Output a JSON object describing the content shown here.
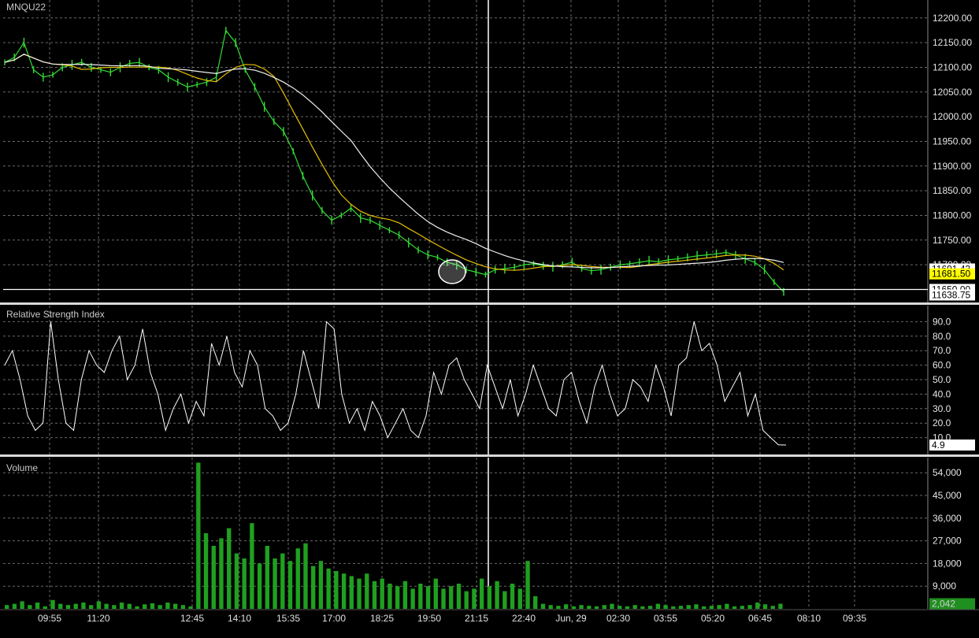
{
  "symbol": "MNQU22",
  "price_panel": {
    "title": "MNQU22",
    "y_ticks": [
      "12200.00",
      "12150.00",
      "12100.00",
      "12050.00",
      "12000.00",
      "11950.00",
      "11900.00",
      "11850.00",
      "11800.00",
      "11750.00",
      "11700.00"
    ],
    "labels": [
      {
        "text": "11691.43",
        "value": 11691.43,
        "bg": "#ffffff",
        "fg": "#000000"
      },
      {
        "text": "11681.50",
        "value": 11681.5,
        "bg": "#ffff00",
        "fg": "#000000"
      },
      {
        "text": "11650.00",
        "value": 11650,
        "bg": "#ffffff",
        "fg": "#000000"
      },
      {
        "text": "11638.75",
        "value": 11638.75,
        "bg": "#ffffff",
        "fg": "#000000"
      }
    ],
    "horizontal_line": 11650
  },
  "rsi_panel": {
    "title": "Relative Strength Index",
    "y_ticks": [
      "90.0",
      "80.0",
      "70.0",
      "60.0",
      "50.0",
      "40.0",
      "30.0",
      "20.0",
      "10.0"
    ],
    "last_label": "4.9"
  },
  "volume_panel": {
    "title": "Volume",
    "y_ticks": [
      "54,000",
      "45,000",
      "36,000",
      "27,000",
      "18,000",
      "9,000"
    ],
    "last_label": "2,042"
  },
  "x_ticks": [
    "09:55",
    "11:20",
    "12:45",
    "14:10",
    "15:35",
    "17:00",
    "18:25",
    "19:50",
    "21:15",
    "22:40",
    "Jun, 29",
    "02:30",
    "03:55",
    "05:20",
    "06:45",
    "08:10",
    "09:35"
  ],
  "colors": {
    "candle": "#33dd33",
    "ma_fast": "#e8c000",
    "ma_slow": "#f0f0f0",
    "rsi": "#ffffff",
    "volume": "#1fa01f",
    "grid": "#6a6a6a",
    "cursor": "#ffffff"
  },
  "chart_data": [
    {
      "type": "line",
      "title": "MNQU22",
      "ylim": [
        11630,
        12230
      ],
      "x_label_times": [
        "09:55",
        "11:20",
        "12:45",
        "14:10",
        "15:35",
        "17:00",
        "18:25",
        "19:50",
        "21:15",
        "22:40",
        "Jun, 29",
        "02:30",
        "03:55",
        "05:20",
        "06:45",
        "08:10",
        "09:35"
      ],
      "series": [
        {
          "values": [
            12110,
            12120,
            12150,
            12095,
            12080,
            12085,
            12100,
            12105,
            12110,
            12100,
            12095,
            12090,
            12100,
            12108,
            12110,
            12100,
            12095,
            12080,
            12070,
            12060,
            12065,
            12070,
            12080,
            12175,
            12150,
            12095,
            12060,
            12020,
            11990,
            11970,
            11930,
            11880,
            11840,
            11810,
            11790,
            11800,
            11815,
            11795,
            11790,
            11780,
            11770,
            11760,
            11745,
            11730,
            11720,
            11715,
            11705,
            11700,
            11690,
            11685,
            11680,
            11690,
            11692,
            11695,
            11700,
            11702,
            11698,
            11696,
            11700,
            11705,
            11692,
            11688,
            11690,
            11695,
            11700,
            11702,
            11705,
            11708,
            11706,
            11710,
            11712,
            11715,
            11718,
            11720,
            11722,
            11725,
            11720,
            11712,
            11705,
            11690,
            11665,
            11645
          ]
        }
      ]
    },
    {
      "type": "line",
      "title": "Relative Strength Index",
      "ylim": [
        0,
        100
      ],
      "series": [
        {
          "values": [
            60,
            70,
            50,
            25,
            15,
            20,
            90,
            50,
            20,
            15,
            50,
            70,
            60,
            55,
            70,
            80,
            50,
            60,
            85,
            55,
            40,
            15,
            30,
            40,
            20,
            35,
            25,
            75,
            60,
            80,
            55,
            45,
            70,
            60,
            30,
            25,
            15,
            20,
            40,
            70,
            50,
            30,
            90,
            85,
            40,
            20,
            30,
            15,
            35,
            25,
            10,
            20,
            30,
            15,
            10,
            25,
            55,
            40,
            60,
            65,
            50,
            40,
            30,
            60,
            45,
            30,
            50,
            25,
            40,
            60,
            45,
            30,
            25,
            50,
            55,
            35,
            20,
            45,
            60,
            40,
            25,
            30,
            50,
            45,
            35,
            60,
            45,
            25,
            60,
            65,
            90,
            70,
            75,
            60,
            35,
            45,
            55,
            25,
            40,
            15,
            10,
            5,
            4.9
          ]
        }
      ]
    },
    {
      "type": "bar",
      "title": "Volume",
      "ylim": [
        0,
        60000
      ],
      "series": [
        {
          "values": [
            1500,
            2000,
            3000,
            1500,
            2500,
            1000,
            3500,
            2000,
            1500,
            2000,
            2500,
            1500,
            3000,
            2000,
            1500,
            2500,
            2000,
            1000,
            1800,
            2200,
            1500,
            2500,
            2000,
            1500,
            1000,
            58000,
            30000,
            25000,
            28000,
            32000,
            22000,
            20000,
            34000,
            18000,
            25000,
            20000,
            22000,
            19000,
            24000,
            26000,
            17000,
            19000,
            16000,
            15000,
            14000,
            13000,
            12000,
            14000,
            11000,
            12000,
            10000,
            9000,
            11000,
            8000,
            10000,
            9000,
            12000,
            8000,
            9000,
            10000,
            7000,
            8000,
            12000,
            9000,
            11000,
            7000,
            10000,
            8000,
            19000,
            5000,
            2000,
            1500,
            1200,
            1800,
            1000,
            1500,
            1200,
            1000,
            1500,
            2000,
            1200,
            1000,
            1500,
            1000,
            1200,
            2000,
            1500,
            1000,
            1200,
            1500,
            1800,
            1000,
            1200,
            1500,
            2000,
            1000,
            1200,
            1500,
            2500,
            1800,
            1200,
            2042
          ]
        }
      ]
    }
  ]
}
